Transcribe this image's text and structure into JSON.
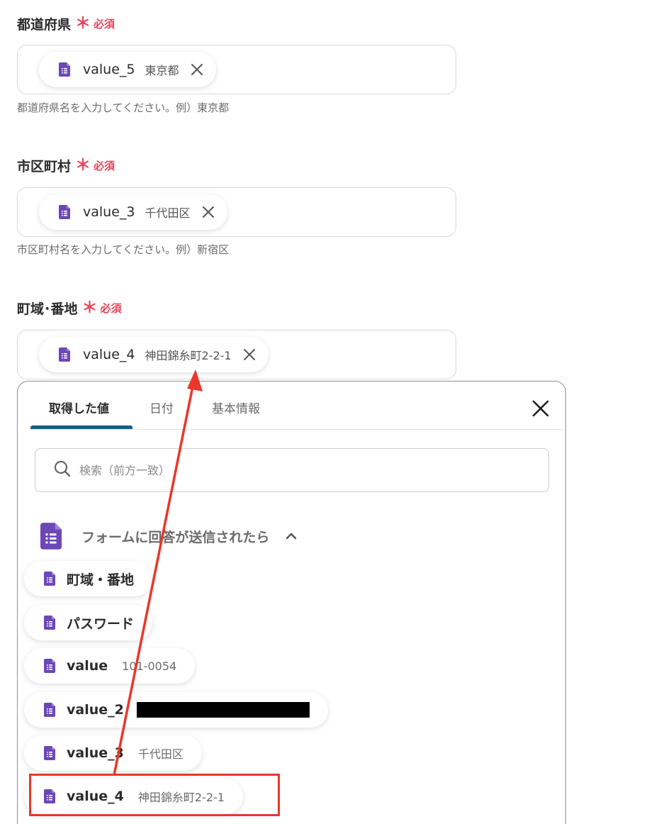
{
  "colors": {
    "required": "#e8435a",
    "form_icon": "#6b47b8",
    "tab_underline": "#1b5b83",
    "annotation": "#e9372b"
  },
  "fields": [
    {
      "label": "都道府県",
      "required_mark": "＊",
      "required_text": "必須",
      "chip_key": "value_5",
      "chip_value": "東京都",
      "help": "都道府県名を入力してください。例）東京都"
    },
    {
      "label": "市区町村",
      "required_mark": "＊",
      "required_text": "必須",
      "chip_key": "value_3",
      "chip_value": "千代田区",
      "help": "市区町村名を入力してください。例）新宿区"
    },
    {
      "label": "町域･番地",
      "required_mark": "＊",
      "required_text": "必須",
      "chip_key": "value_4",
      "chip_value": "神田錦糸町2-2-1"
    }
  ],
  "panel": {
    "tabs": [
      {
        "label": "取得した値",
        "active": true
      },
      {
        "label": "日付",
        "active": false
      },
      {
        "label": "基本情報",
        "active": false
      }
    ],
    "close_icon": "close-icon",
    "search": {
      "placeholder": "検索（前方一致）",
      "value": ""
    },
    "group": {
      "title": "フォームに回答が送信されたら",
      "icon": "google-forms-icon",
      "expanded": true
    },
    "items": [
      {
        "key": "町域・番地",
        "value": ""
      },
      {
        "key": "パスワード",
        "value": ""
      },
      {
        "key": "value",
        "value": "101-0054"
      },
      {
        "key": "value_2",
        "value": "",
        "redacted": true
      },
      {
        "key": "value_3",
        "value": "千代田区"
      },
      {
        "key": "value_4",
        "value": "神田錦糸町2-2-1",
        "highlighted": true
      }
    ]
  }
}
